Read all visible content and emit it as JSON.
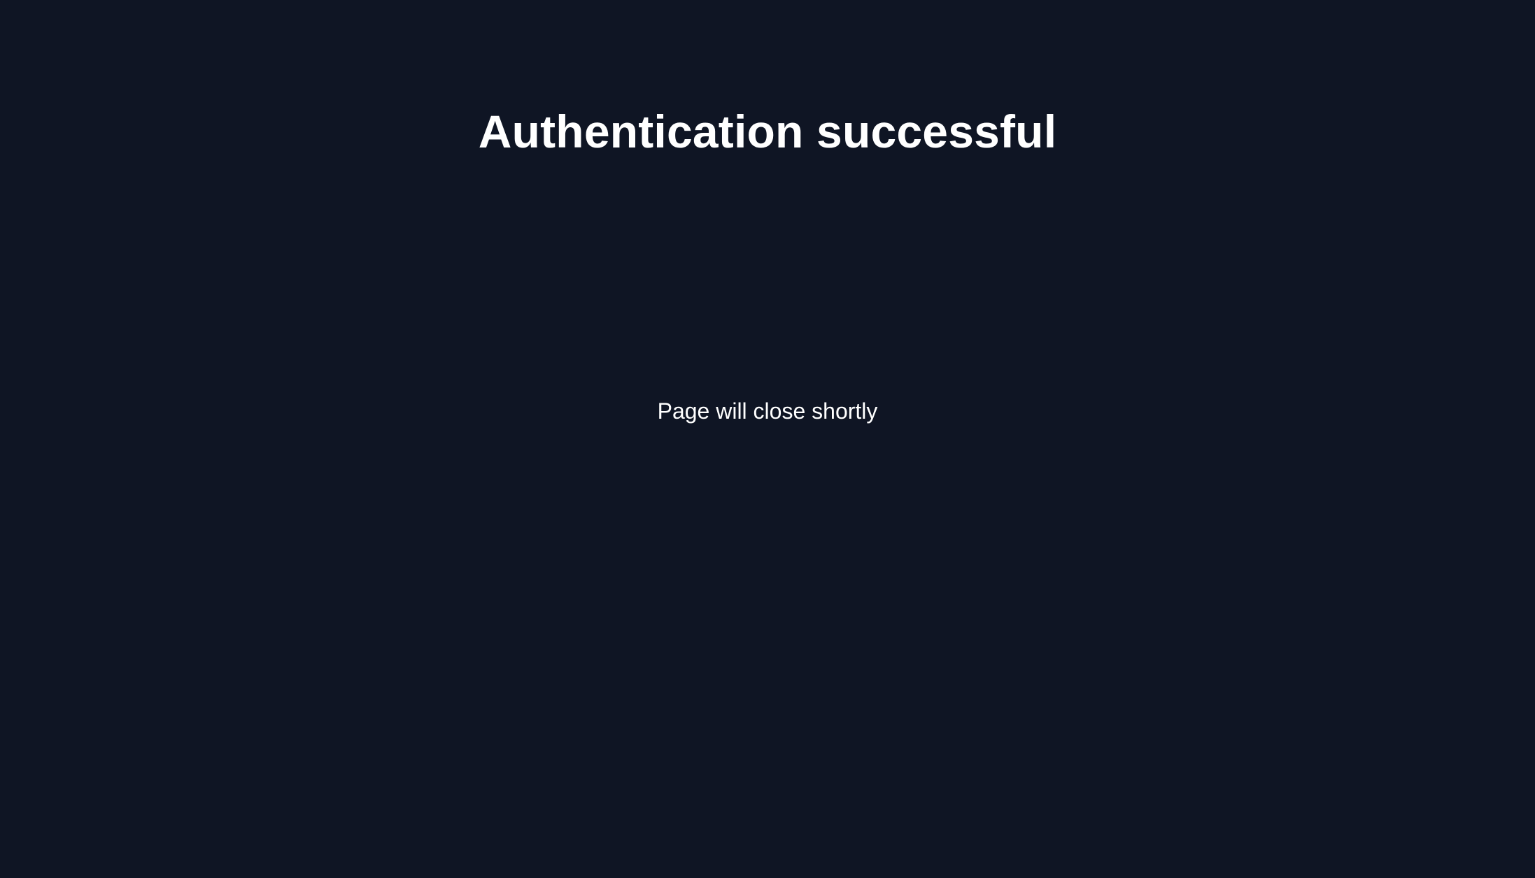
{
  "page": {
    "background_color": "#0f1524",
    "text_color": "#ffffff",
    "heading": "Authentication successful",
    "message": "Page will close shortly"
  }
}
